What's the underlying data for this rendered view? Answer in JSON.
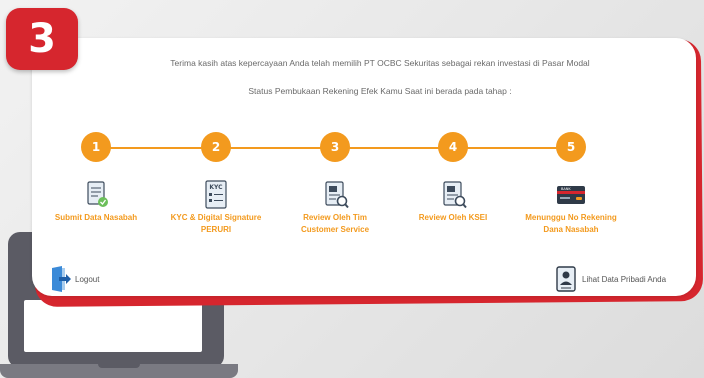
{
  "step_badge": "3",
  "intro_text": "Terima kasih atas kepercayaan Anda telah memilih PT OCBC Sekuritas sebagai rekan investasi di Pasar Modal",
  "status_text": "Status Pembukaan Rekening Efek Kamu Saat ini berada pada tahap :",
  "steps": [
    {
      "number": "1",
      "label_line1": "Submit Data Nasabah",
      "label_line2": "",
      "icon": "document-check-icon"
    },
    {
      "number": "2",
      "label_line1": "KYC & Digital Signature",
      "label_line2": "PERURI",
      "icon": "kyc-document-icon"
    },
    {
      "number": "3",
      "label_line1": "Review Oleh Tim",
      "label_line2": "Customer Service",
      "icon": "document-search-icon"
    },
    {
      "number": "4",
      "label_line1": "Review Oleh KSEI",
      "label_line2": "",
      "icon": "document-search-icon"
    },
    {
      "number": "5",
      "label_line1": "Menunggu No Rekening",
      "label_line2": "Dana Nasabah",
      "icon": "bank-card-icon"
    }
  ],
  "logout_label": "Logout",
  "profile_label": "Lihat Data Pribadi Anda",
  "kyc_icon_text": "KYC",
  "card_icon_text": "BANK",
  "colors": {
    "accent": "#f39a1e",
    "brand_red": "#d6262e"
  }
}
